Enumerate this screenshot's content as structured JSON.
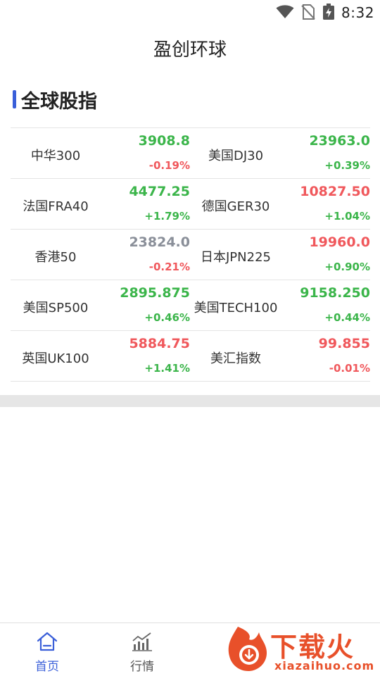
{
  "status_bar": {
    "time": "8:32"
  },
  "app_title": "盈创环球",
  "section": {
    "title": "全球股指",
    "accent_color": "#3a5fd9"
  },
  "indices": [
    {
      "name": "中华300",
      "price": "3908.8",
      "change": "-0.19%",
      "price_dir": "up",
      "change_dir": "down"
    },
    {
      "name": "美国DJ30",
      "price": "23963.0",
      "change": "+0.39%",
      "price_dir": "up",
      "change_dir": "up"
    },
    {
      "name": "法国FRA40",
      "price": "4477.25",
      "change": "+1.79%",
      "price_dir": "up",
      "change_dir": "up"
    },
    {
      "name": "德国GER30",
      "price": "10827.50",
      "change": "+1.04%",
      "price_dir": "down",
      "change_dir": "up"
    },
    {
      "name": "香港50",
      "price": "23824.0",
      "change": "-0.21%",
      "price_dir": "flat",
      "change_dir": "down"
    },
    {
      "name": "日本JPN225",
      "price": "19960.0",
      "change": "+0.90%",
      "price_dir": "down",
      "change_dir": "up"
    },
    {
      "name": "美国SP500",
      "price": "2895.875",
      "change": "+0.46%",
      "price_dir": "up",
      "change_dir": "up"
    },
    {
      "name": "美国TECH100",
      "price": "9158.250",
      "change": "+0.44%",
      "price_dir": "up",
      "change_dir": "up"
    },
    {
      "name": "英国UK100",
      "price": "5884.75",
      "change": "+1.41%",
      "price_dir": "down",
      "change_dir": "up"
    },
    {
      "name": "美汇指数",
      "price": "99.855",
      "change": "-0.01%",
      "price_dir": "down",
      "change_dir": "down"
    }
  ],
  "colors": {
    "up": "#3bb54a",
    "down": "#f0585c",
    "flat": "#8a8f99",
    "nav_active": "#3a5fd9"
  },
  "bottom_nav": [
    {
      "label": "首页",
      "icon": "home-icon",
      "active": true
    },
    {
      "label": "行情",
      "icon": "chart-bars-icon",
      "active": false
    }
  ],
  "watermark": {
    "text": "下载火",
    "url": "xiazaihuo.com"
  }
}
